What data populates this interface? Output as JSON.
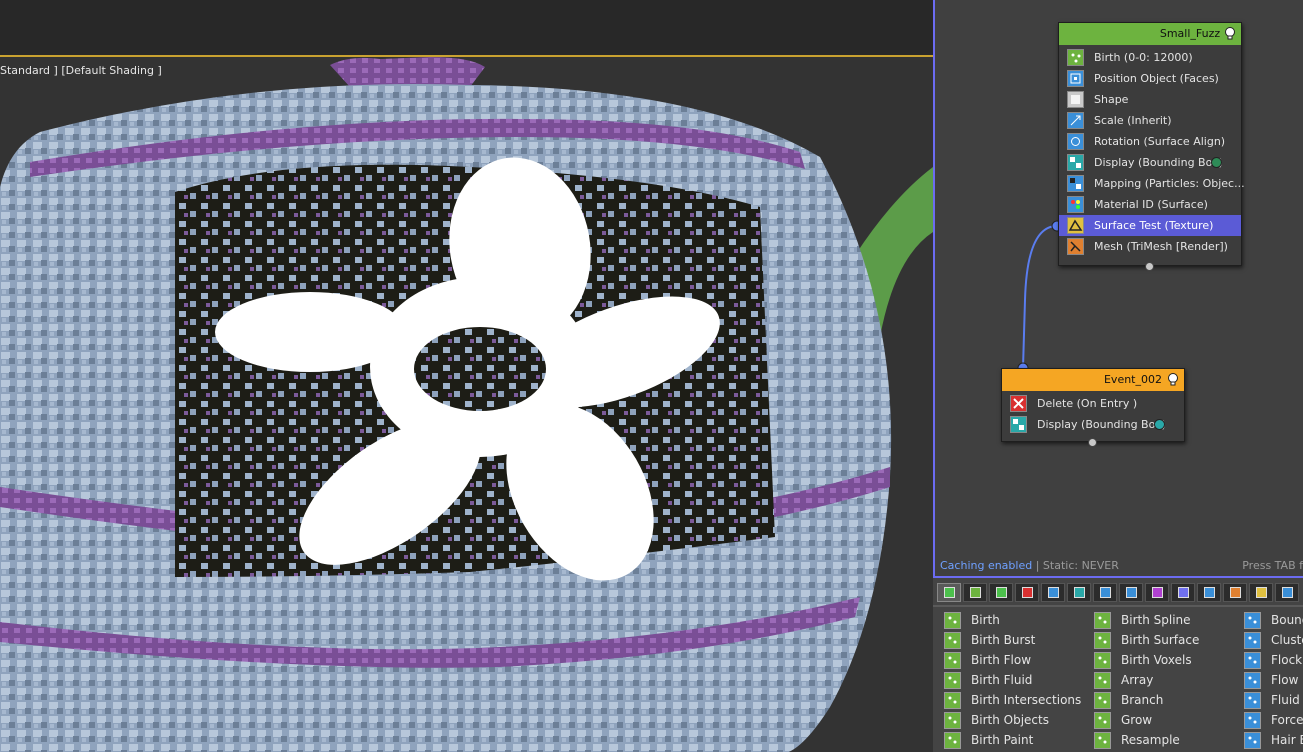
{
  "viewport": {
    "label": "Standard ] [Default Shading ]"
  },
  "flow": {
    "status_cache": "Caching enabled",
    "status_static": " | Static: NEVER",
    "press_tab": "Press TAB f",
    "nodes": [
      {
        "title": "Small_Fuzz",
        "title_color": "#6db33f",
        "operators": [
          {
            "label": "Birth (0-0: 12000)",
            "icon": "birth-icon",
            "color": "#6db33f"
          },
          {
            "label": "Position Object (Faces)",
            "icon": "position-object-icon",
            "color": "#3a8fd8"
          },
          {
            "label": "Shape",
            "icon": "shape-icon",
            "color": "#c9c9c9"
          },
          {
            "label": "Scale (Inherit)",
            "icon": "scale-icon",
            "color": "#3a8fd8"
          },
          {
            "label": "Rotation (Surface Align)",
            "icon": "rotation-icon",
            "color": "#3a8fd8"
          },
          {
            "label": "Display (Bounding Box)",
            "icon": "display-icon",
            "color": "#2aa8a8",
            "dot": "#2e8b57"
          },
          {
            "label": "Mapping (Particles: Objec...",
            "icon": "mapping-icon",
            "color": "#3a8fd8"
          },
          {
            "label": "Material ID (Surface)",
            "icon": "material-id-icon",
            "color": "#3a8fd8"
          },
          {
            "label": "Surface Test (Texture)",
            "icon": "surface-test-icon",
            "color": "#e0c040",
            "selected": true
          },
          {
            "label": "Mesh (TriMesh [Render])",
            "icon": "mesh-icon",
            "color": "#e08030"
          }
        ]
      },
      {
        "title": "Event_002",
        "title_color": "#f5a623",
        "operators": [
          {
            "label": "Delete (On Entry )",
            "icon": "delete-icon",
            "color": "#d93030"
          },
          {
            "label": "Display (Bounding Box)",
            "icon": "display-icon",
            "color": "#2aa8a8",
            "dot": "#2aa8a8"
          }
        ]
      }
    ]
  },
  "depot": {
    "tab_colors": [
      "#4cc04c",
      "#6db33f",
      "#4cc04c",
      "#d93030",
      "#3a8fd8",
      "#2aa8a8",
      "#3a8fd8",
      "#3a8fd8",
      "#b040d0",
      "#7070f0",
      "#3a8fd8",
      "#e08030",
      "#e0c040",
      "#3a8fd8"
    ],
    "columns": [
      [
        {
          "label": "Birth",
          "color": "#6db33f"
        },
        {
          "label": "Birth Burst",
          "color": "#6db33f"
        },
        {
          "label": "Birth Flow",
          "color": "#6db33f"
        },
        {
          "label": "Birth Fluid",
          "color": "#6db33f"
        },
        {
          "label": "Birth Intersections",
          "color": "#6db33f"
        },
        {
          "label": "Birth Objects",
          "color": "#6db33f"
        },
        {
          "label": "Birth Paint",
          "color": "#6db33f"
        }
      ],
      [
        {
          "label": "Birth Spline",
          "color": "#6db33f"
        },
        {
          "label": "Birth Surface",
          "color": "#6db33f"
        },
        {
          "label": "Birth Voxels",
          "color": "#6db33f"
        },
        {
          "label": "Array",
          "color": "#6db33f"
        },
        {
          "label": "Branch",
          "color": "#6db33f"
        },
        {
          "label": "Grow",
          "color": "#6db33f"
        },
        {
          "label": "Resample",
          "color": "#6db33f"
        }
      ],
      [
        {
          "label": "Bound",
          "color": "#3a8fd8"
        },
        {
          "label": "Cluste",
          "color": "#3a8fd8"
        },
        {
          "label": "Flock",
          "color": "#3a8fd8"
        },
        {
          "label": "Flow I",
          "color": "#3a8fd8"
        },
        {
          "label": "Fluid",
          "color": "#3a8fd8"
        },
        {
          "label": "Force",
          "color": "#3a8fd8"
        },
        {
          "label": "Hair B",
          "color": "#3a8fd8"
        }
      ]
    ]
  }
}
